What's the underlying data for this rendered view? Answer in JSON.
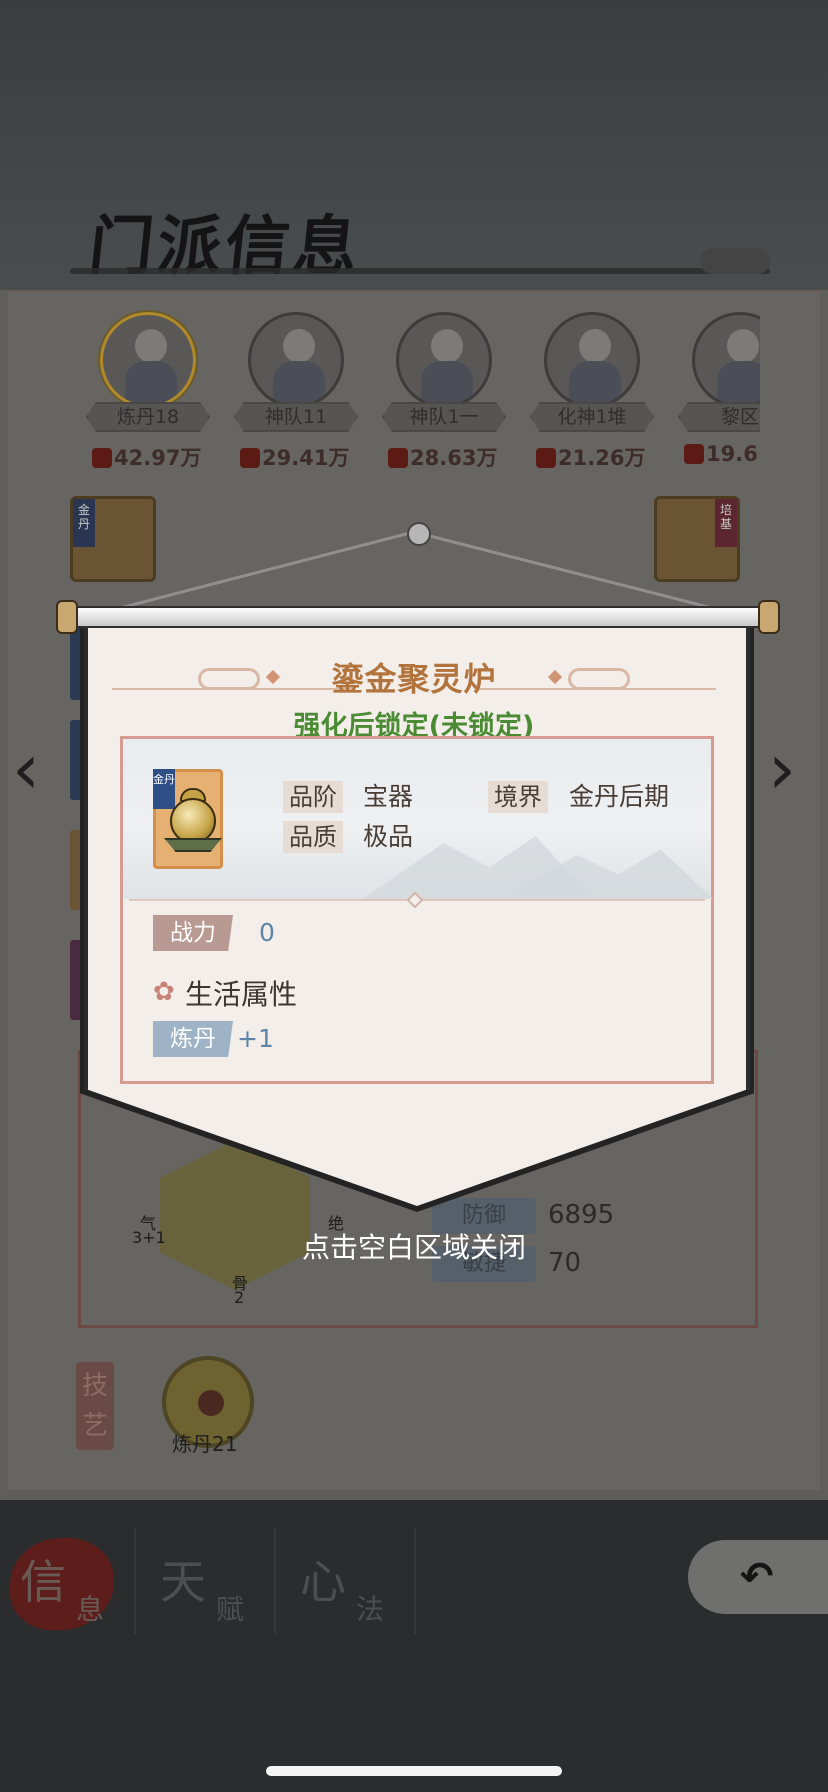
{
  "screen": {
    "title": "门派信息"
  },
  "members": [
    {
      "name": "炼丹18",
      "power": "42.97万"
    },
    {
      "name": "神队11",
      "power": "29.41万"
    },
    {
      "name": "神队1一",
      "power": "28.63万"
    },
    {
      "name": "化神1堆",
      "power": "21.26万"
    },
    {
      "name": "黎区",
      "power": "19.6"
    }
  ],
  "background": {
    "stat_labels": {
      "qi": "气",
      "qi_val": "3+1",
      "bone": "骨",
      "bone_val": "2",
      "jue": "绝"
    },
    "stats": [
      {
        "label": "防御",
        "value": "6895"
      },
      {
        "label": "敏捷",
        "value": "70"
      }
    ],
    "skill_section": "技艺",
    "skill_name": "炼丹21",
    "tabs": [
      {
        "big": "信",
        "small": "息"
      },
      {
        "big": "天",
        "small": "赋"
      },
      {
        "big": "心",
        "small": "法"
      }
    ],
    "side_tags": {
      "left": "金丹",
      "right": "培基"
    }
  },
  "popup": {
    "item_name": "鎏金聚灵炉",
    "lock_status": "强化后锁定(未锁定)",
    "icon_tag": "金丹",
    "grade_label": "品阶",
    "grade_value": "宝器",
    "realm_label": "境界",
    "realm_value": "金丹后期",
    "quality_label": "品质",
    "quality_value": "极品",
    "power_label": "战力",
    "power_value": "0",
    "life_section_title": "生活属性",
    "attr_label": "炼丹",
    "attr_value": "+1",
    "close_hint": "点击空白区域关闭"
  },
  "colors": {
    "item_name": "#b3733c",
    "lock_status": "#4b8b33",
    "value_blue": "#5e84a8"
  }
}
